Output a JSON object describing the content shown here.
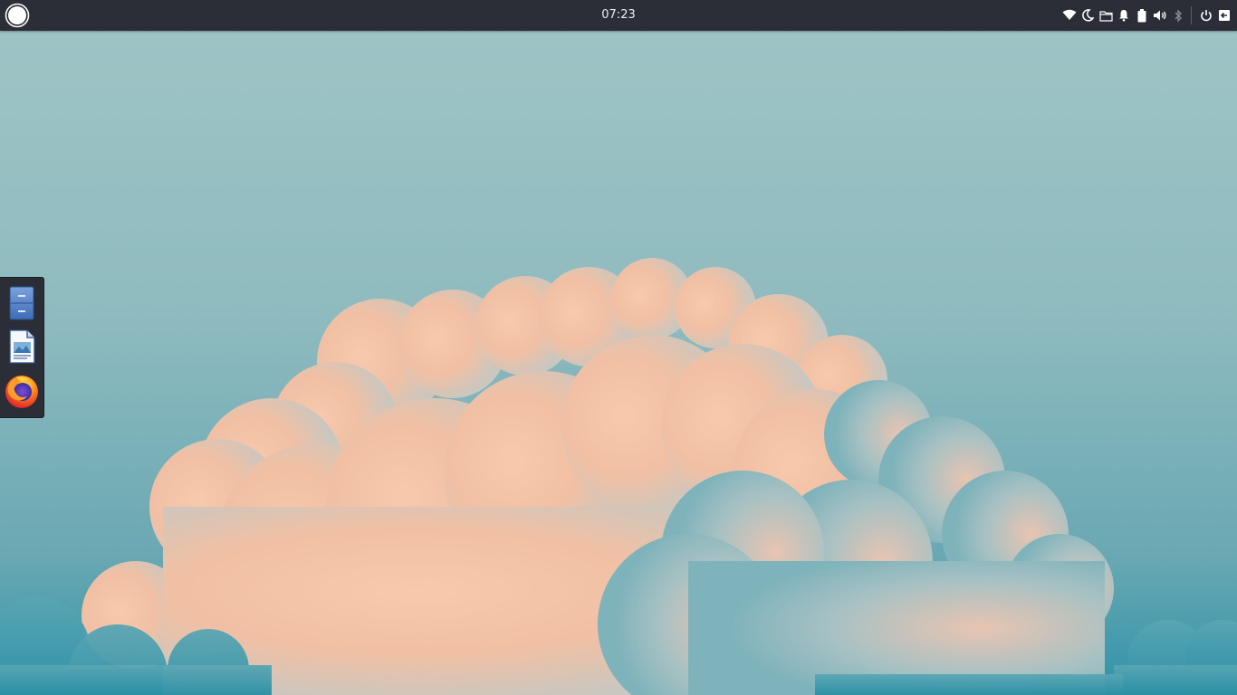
{
  "panel": {
    "clock": "07:23",
    "menu_icon": "app-menu-circle-icon",
    "tray_icons": [
      "wifi-icon",
      "night-mode-moon-icon",
      "files-folder-icon",
      "notifications-bell-icon",
      "battery-icon",
      "volume-icon",
      "bluetooth-icon",
      "power-icon",
      "logout-icon"
    ],
    "background_color": "#2b2e37",
    "text_color": "#ececec"
  },
  "dock": {
    "items": [
      {
        "name": "file-manager-icon"
      },
      {
        "name": "libreoffice-writer-icon"
      },
      {
        "name": "firefox-icon"
      }
    ]
  },
  "wallpaper": {
    "description_colors": [
      "#a0c4c6",
      "#f2c3a6",
      "#2f93a8"
    ]
  }
}
